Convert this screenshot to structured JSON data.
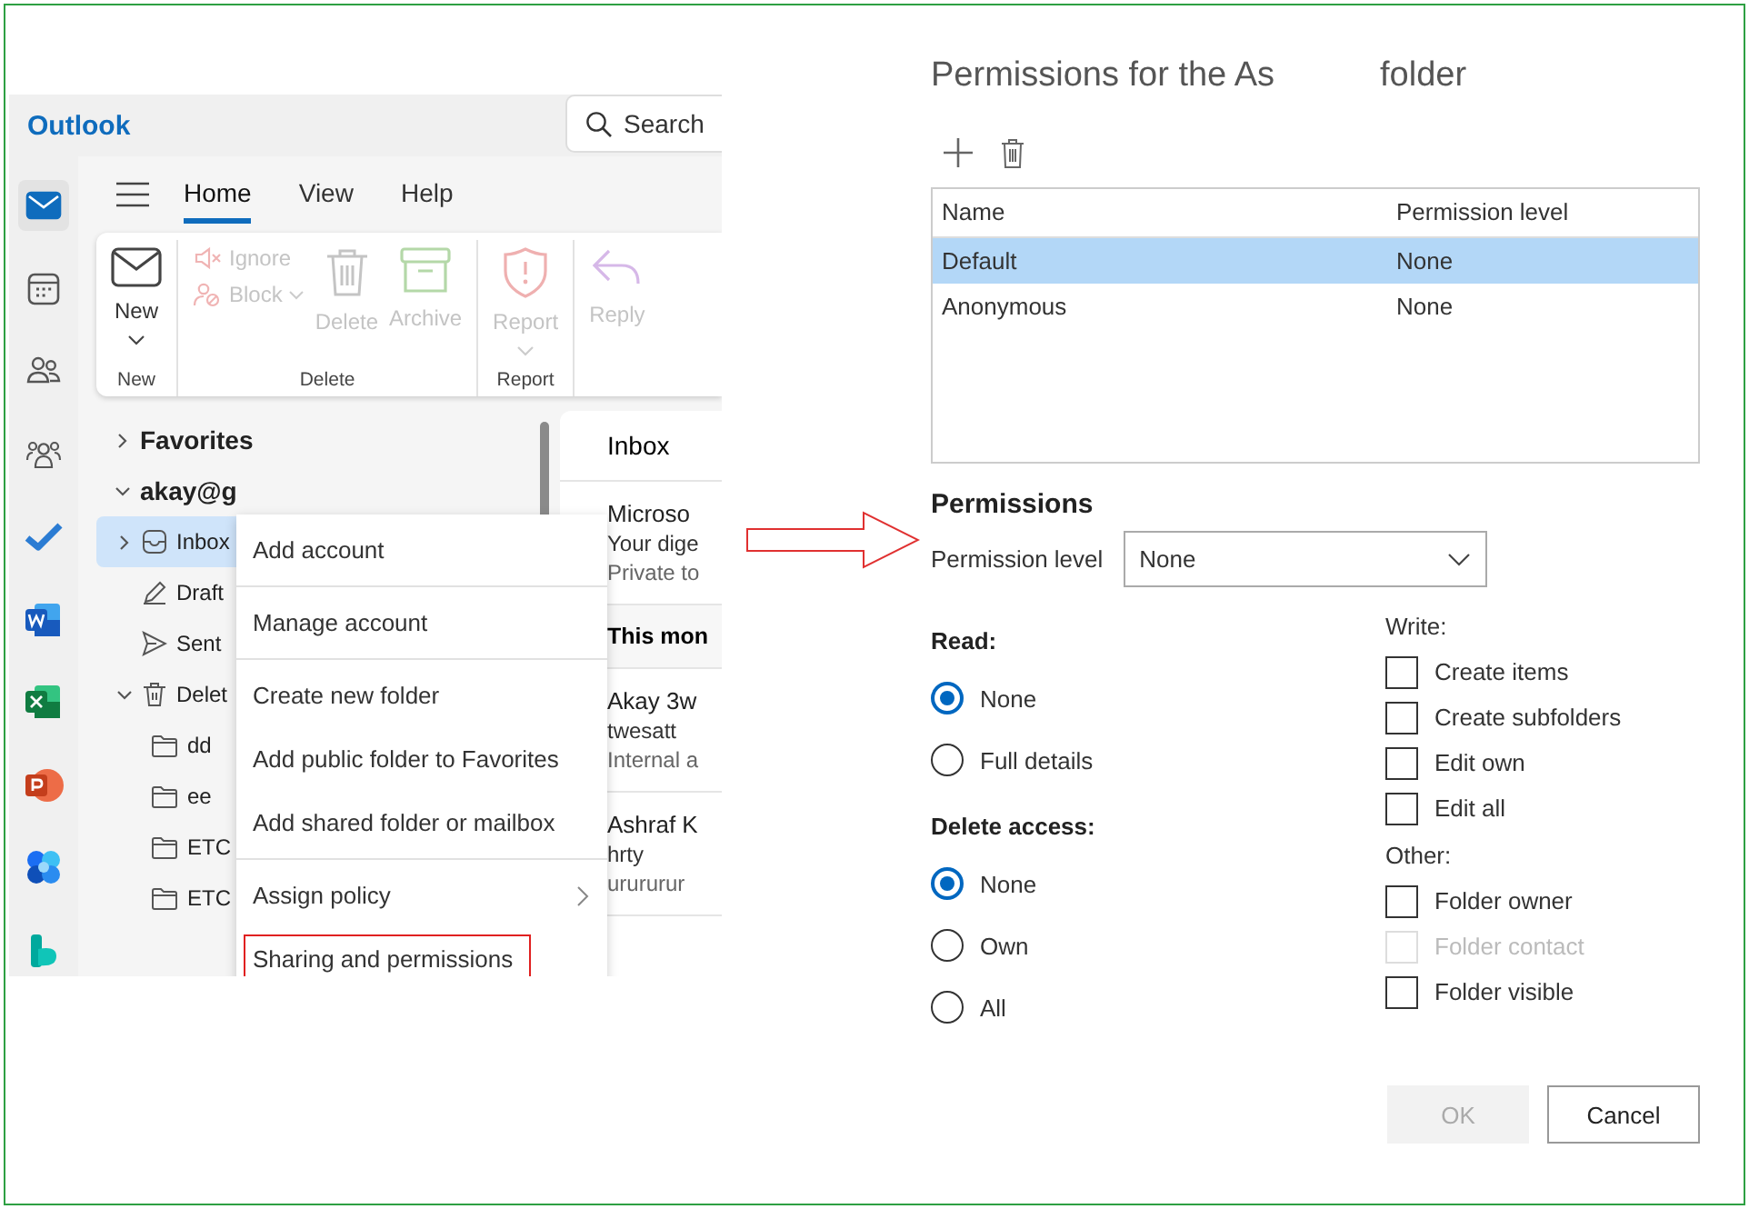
{
  "outlook": {
    "app_name": "Outlook",
    "search_placeholder": "Search",
    "rail": [
      {
        "kind": "mail",
        "selected": true
      },
      {
        "kind": "calendar",
        "selected": false
      },
      {
        "kind": "people",
        "selected": false
      },
      {
        "kind": "groups",
        "selected": false
      },
      {
        "kind": "todo",
        "selected": false
      },
      {
        "kind": "word",
        "selected": false
      },
      {
        "kind": "excel",
        "selected": false
      },
      {
        "kind": "powerpoint",
        "selected": false
      },
      {
        "kind": "apps",
        "selected": false
      },
      {
        "kind": "bookings",
        "selected": false
      }
    ],
    "tabs": [
      {
        "label": "Home",
        "selected": true
      },
      {
        "label": "View",
        "selected": false
      },
      {
        "label": "Help",
        "selected": false
      }
    ],
    "ribbon": [
      {
        "label": "New",
        "items": [
          {
            "kind": "new",
            "label": "New",
            "disabled": false,
            "dropdown": true
          }
        ]
      },
      {
        "label": "Delete",
        "items": [
          {
            "kind": "ignore",
            "label": "Ignore",
            "disabled": true,
            "dropdown": false
          },
          {
            "kind": "block",
            "label": "Block",
            "disabled": true,
            "dropdown": true
          },
          {
            "kind": "delete",
            "label": "Delete",
            "disabled": true,
            "dropdown": false
          },
          {
            "kind": "archive",
            "label": "Archive",
            "disabled": true,
            "dropdown": false
          }
        ]
      },
      {
        "label": "Report",
        "items": [
          {
            "kind": "report",
            "label": "Report",
            "disabled": true,
            "dropdown": true
          }
        ]
      },
      {
        "items": [
          {
            "kind": "reply",
            "label": "Reply",
            "disabled": true,
            "dropdown": false
          }
        ]
      }
    ],
    "folders": [
      {
        "label": "Favorites",
        "expanded": false,
        "selected": false
      },
      {
        "label": "akay@g",
        "expanded": true,
        "selected": false,
        "children": [
          {
            "label": "Inbox",
            "kind": "inbox",
            "expanded": false,
            "selected": true
          },
          {
            "label": "Draft",
            "kind": "drafts",
            "selected": false
          },
          {
            "label": "Sent",
            "kind": "sent",
            "selected": false
          },
          {
            "label": "Delet",
            "kind": "deleted",
            "expanded": true,
            "selected": false,
            "children": [
              {
                "label": "dd",
                "kind": "folder",
                "selected": false
              },
              {
                "label": "ee",
                "kind": "folder",
                "selected": false
              },
              {
                "label": "ETC",
                "kind": "folder",
                "selected": false
              },
              {
                "label": "ETC",
                "kind": "folder",
                "selected": false
              }
            ]
          }
        ]
      }
    ],
    "list_title": "Inbox",
    "messages": [
      {
        "kind": "message",
        "sender": "Microso",
        "subject": "Your dige",
        "preview": "Private to"
      },
      {
        "kind": "heading",
        "text": "This mon"
      },
      {
        "kind": "message",
        "sender": "Akay 3w",
        "subject": "twesatt",
        "preview": "Internal a"
      },
      {
        "kind": "message",
        "sender": "Ashraf K",
        "subject": "hrty",
        "preview": "urururur"
      }
    ],
    "context_menu": [
      [
        {
          "label": "Add account",
          "submenu": false,
          "marked": false
        }
      ],
      [
        {
          "label": "Manage account",
          "submenu": false,
          "marked": false
        }
      ],
      [
        {
          "label": "Create new folder",
          "submenu": false,
          "marked": false
        },
        {
          "label": "Add public folder to Favorites",
          "submenu": false,
          "marked": false
        },
        {
          "label": "Add shared folder or mailbox",
          "submenu": false,
          "marked": false
        }
      ],
      [
        {
          "label": "Assign policy",
          "submenu": true,
          "marked": false
        },
        {
          "label": "Sharing and permissions",
          "submenu": false,
          "marked": true
        }
      ]
    ]
  },
  "dialog": {
    "title": [
      "Permissions for the As",
      "folder"
    ],
    "columns": [
      "Name",
      "Permission level"
    ],
    "users": [
      {
        "name": "Default",
        "level": "None",
        "selected": true
      },
      {
        "name": "Anonymous",
        "level": "None",
        "selected": false
      }
    ],
    "permissions_heading": "Permissions",
    "level_label": "Permission level",
    "level_value": "None",
    "read": {
      "label": "Read:",
      "options": [
        {
          "label": "None",
          "selected": true
        },
        {
          "label": "Full details",
          "selected": false
        }
      ]
    },
    "delete_access": {
      "label": "Delete access:",
      "options": [
        {
          "label": "None",
          "selected": true
        },
        {
          "label": "Own",
          "selected": false
        },
        {
          "label": "All",
          "selected": false
        }
      ]
    },
    "write": {
      "label": "Write:",
      "options": [
        {
          "label": "Create items",
          "checked": false,
          "disabled": false
        },
        {
          "label": "Create subfolders",
          "checked": false,
          "disabled": false
        },
        {
          "label": "Edit own",
          "checked": false,
          "disabled": false
        },
        {
          "label": "Edit all",
          "checked": false,
          "disabled": false
        }
      ]
    },
    "other": {
      "label": "Other:",
      "options": [
        {
          "label": "Folder owner",
          "checked": false,
          "disabled": false
        },
        {
          "label": "Folder contact",
          "checked": false,
          "disabled": true
        },
        {
          "label": "Folder visible",
          "checked": false,
          "disabled": false
        }
      ]
    },
    "buttons": [
      {
        "label": "OK",
        "disabled": true
      },
      {
        "label": "Cancel",
        "disabled": false
      }
    ]
  }
}
